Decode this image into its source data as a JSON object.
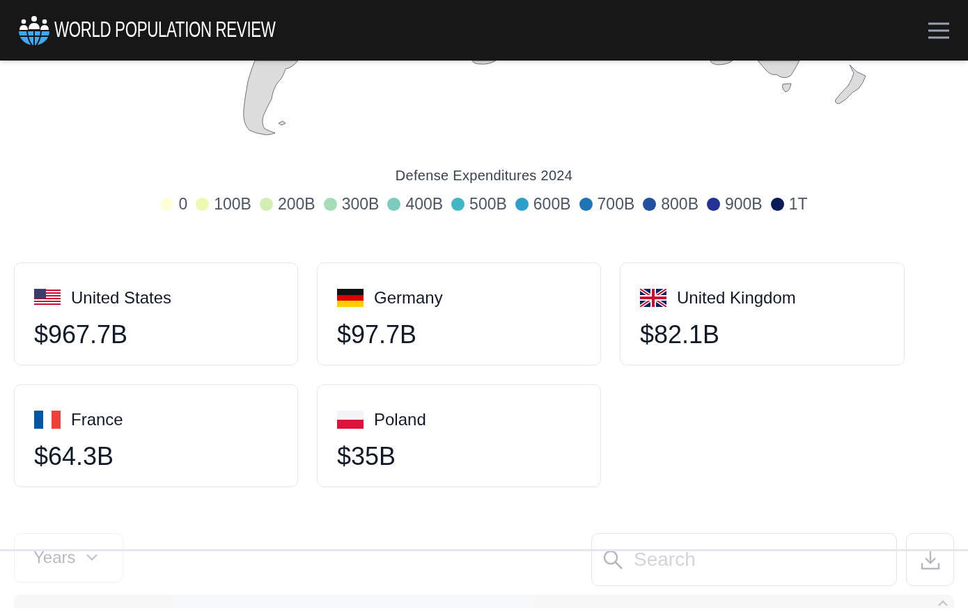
{
  "header": {
    "title": "WORLD POPULATION REVIEW"
  },
  "map": {
    "legend_title": "Defense Expenditures 2024",
    "legend": [
      {
        "label": "0",
        "color": "#ffffd9"
      },
      {
        "label": "100B",
        "color": "#edf8b1"
      },
      {
        "label": "200B",
        "color": "#d3eeb3"
      },
      {
        "label": "300B",
        "color": "#a6dcb6"
      },
      {
        "label": "400B",
        "color": "#7accbf"
      },
      {
        "label": "500B",
        "color": "#41b6c4"
      },
      {
        "label": "600B",
        "color": "#2c9fcb"
      },
      {
        "label": "700B",
        "color": "#1f74b4"
      },
      {
        "label": "800B",
        "color": "#2150a0"
      },
      {
        "label": "900B",
        "color": "#243393"
      },
      {
        "label": "1T",
        "color": "#081d58"
      }
    ]
  },
  "cards": [
    {
      "kind": "us",
      "country": "United States",
      "value": "$967.7B"
    },
    {
      "kind": "de",
      "country": "Germany",
      "value": "$97.7B"
    },
    {
      "kind": "gb",
      "country": "United Kingdom",
      "value": "$82.1B"
    },
    {
      "kind": "fr",
      "country": "France",
      "value": "$64.3B"
    },
    {
      "kind": "pl",
      "country": "Poland",
      "value": "$35B"
    }
  ],
  "toolbar": {
    "years_label": "Years",
    "search_placeholder": "Search"
  }
}
